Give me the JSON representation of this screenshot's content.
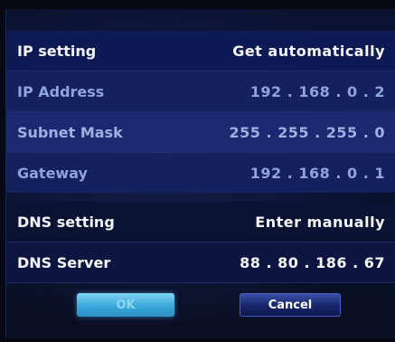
{
  "settings": {
    "ip_setting": {
      "label": "IP setting",
      "value": "Get automatically"
    },
    "ip_address": {
      "label": "IP Address",
      "value": "192 . 168 . 0 . 2"
    },
    "subnet_mask": {
      "label": "Subnet Mask",
      "value": "255 . 255 . 255 . 0"
    },
    "gateway": {
      "label": "Gateway",
      "value": "192 . 168 . 0 . 1"
    },
    "dns_setting": {
      "label": "DNS setting",
      "value": "Enter manually"
    },
    "dns_server": {
      "label": "DNS Server",
      "value": "88 . 80 . 186 . 67"
    }
  },
  "buttons": {
    "ok": "OK",
    "cancel": "Cancel"
  },
  "colors": {
    "background": "#0a0f24",
    "row_highlight": "#13215e",
    "ok_button": "#3aa9dc",
    "cancel_button": "#17256a"
  }
}
